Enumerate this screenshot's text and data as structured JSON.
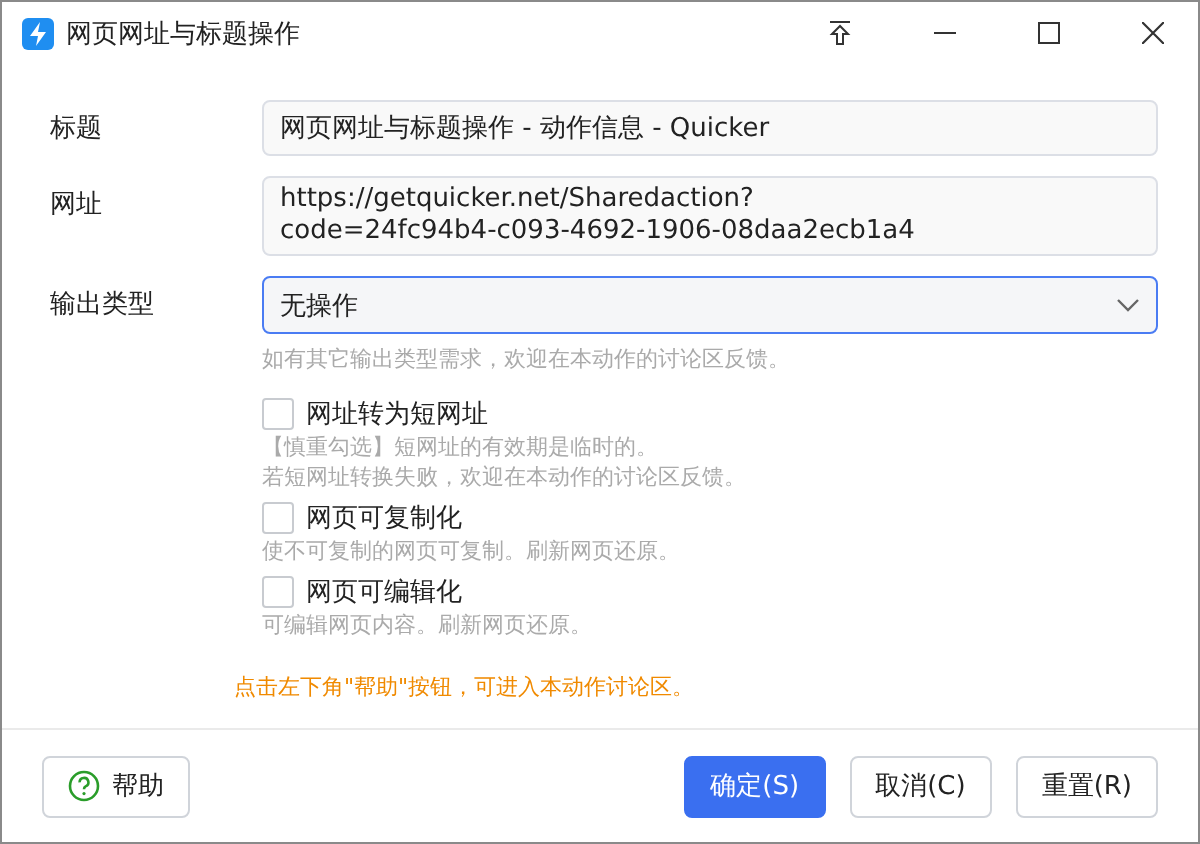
{
  "window": {
    "title": "网页网址与标题操作"
  },
  "fields": [
    {
      "kind": "text",
      "label": "标题",
      "value": "网页网址与标题操作 - 动作信息 - Quicker"
    },
    {
      "kind": "multiline",
      "label": "网址",
      "value": "https://getquicker.net/Sharedaction?code=24fc94b4-c093-4692-1906-08daa2ecb1a4"
    },
    {
      "kind": "dropdown",
      "label": "输出类型",
      "value": "无操作",
      "hint": "如有其它输出类型需求，欢迎在本动作的讨论区反馈。"
    }
  ],
  "options": [
    {
      "label": "网址转为短网址",
      "checked": false,
      "hints": [
        "【慎重勾选】短网址的有效期是临时的。",
        "若短网址转换失败，欢迎在本动作的讨论区反馈。"
      ]
    },
    {
      "label": "网页可复制化",
      "checked": false,
      "hints": [
        "使不可复制的网页可复制。刷新网页还原。"
      ]
    },
    {
      "label": "网页可编辑化",
      "checked": false,
      "hints": [
        "可编辑网页内容。刷新网页还原。"
      ]
    }
  ],
  "notice": "点击左下角\"帮助\"按钮，可进入本动作讨论区。",
  "help_button": "帮助",
  "buttons": [
    {
      "label": "确定(S)",
      "kind": "primary"
    },
    {
      "label": "取消(C)",
      "kind": "normal"
    },
    {
      "label": "重置(R)",
      "kind": "normal"
    }
  ]
}
